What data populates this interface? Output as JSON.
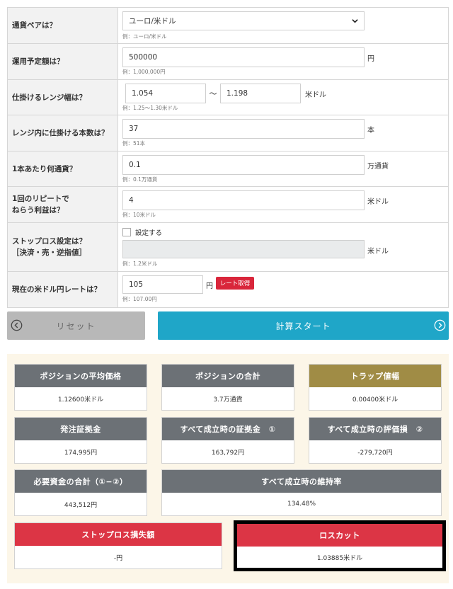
{
  "form": {
    "pair": {
      "label": "通貨ペアは？",
      "value": "ユーロ/米ドル",
      "hint": "例：ユーロ/米ドル"
    },
    "budget": {
      "label": "運用予定額は？",
      "value": "500000",
      "unit": "円",
      "hint": "例：1,000,000円"
    },
    "range": {
      "label": "仕掛けるレンジ幅は？",
      "from": "1.054",
      "sep": "〜",
      "to": "1.198",
      "unit": "米ドル",
      "hint": "例：1.25〜1.30米ドル"
    },
    "count": {
      "label": "レンジ内に仕掛ける本数は？",
      "value": "37",
      "unit": "本",
      "hint": "例：51本"
    },
    "lot": {
      "label": "1本あたり何通貨？",
      "value": "0.1",
      "unit": "万通貨",
      "hint": "例：0.1万通貨"
    },
    "profit": {
      "label_line1": "1回のリピートで",
      "label_line2": "ねらう利益は？",
      "value": "4",
      "unit": "米ドル",
      "hint": "例：10米ドル"
    },
    "stoploss": {
      "label_line1": "ストップロス設定は？",
      "label_line2": "［決済・売・逆指値］",
      "checkbox_label": "設定する",
      "checked": false,
      "value": "",
      "unit": "米ドル",
      "hint": "例：1.2米ドル"
    },
    "rate": {
      "label": "現在の米ドル円レートは？",
      "value": "105",
      "unit": "円",
      "button": "レート取得",
      "hint": "例：107.00円"
    }
  },
  "buttons": {
    "reset": "リセット",
    "calc": "計算スタート"
  },
  "results": {
    "avg_price": {
      "title": "ポジションの平均価格",
      "value": "1.12600米ドル"
    },
    "position_total": {
      "title": "ポジションの合計",
      "value": "3.7万通貨"
    },
    "trap_width": {
      "title": "トラップ値幅",
      "value": "0.00400米ドル"
    },
    "order_margin": {
      "title": "発注証拠金",
      "value": "174,995円"
    },
    "filled_margin": {
      "title": "すべて成立時の証拠金　①",
      "value": "163,792円"
    },
    "filled_loss": {
      "title": "すべて成立時の評価損　②",
      "value": "-279,720円"
    },
    "required_funds": {
      "title": "必要資金の合計（①−②）",
      "value": "443,512円"
    },
    "maintenance_ratio": {
      "title": "すべて成立時の維持率",
      "value": "134.48%"
    },
    "stoploss_amount": {
      "title": "ストップロス損失額",
      "value": "-円"
    },
    "losscut": {
      "title": "ロスカット",
      "value": "1.03885米ドル"
    }
  },
  "colors": {
    "header_gray": "#6c7176",
    "header_gold": "#a08c45",
    "header_red": "#dc3545",
    "calc_button": "#1fa6c8",
    "results_bg": "#fcf6e8"
  }
}
